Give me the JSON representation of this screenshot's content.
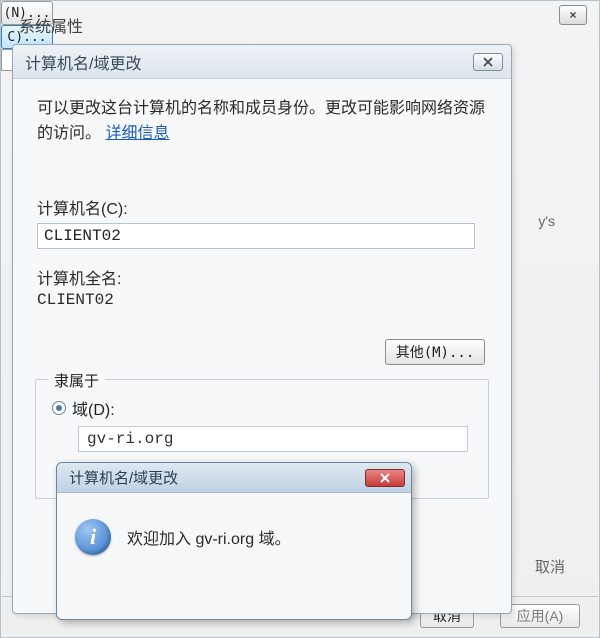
{
  "sys": {
    "title": "系统属性",
    "close_label": "×",
    "frag_ys": "y's",
    "frag_n": "(N)...",
    "frag_c": "C)...",
    "frag_cancel2": "取消",
    "frag_cancel3": "取消",
    "frag_apply": "应用(A)"
  },
  "dlg": {
    "title": "计算机名/域更改",
    "desc_prefix": "可以更改这台计算机的名称和成员身份。更改可能影响网络资源的访问。",
    "link_text": "详细信息",
    "name_label": "计算机名(C):",
    "name_value": "CLIENT02",
    "full_label": "计算机全名:",
    "full_value": "CLIENT02",
    "more_btn": "其他(M)...",
    "group_legend": "隶属于",
    "domain_radio_label": "域(D):",
    "domain_value": "gv-ri.org"
  },
  "msg": {
    "title": "计算机名/域更改",
    "text": "欢迎加入 gv-ri.org 域。",
    "icon_glyph": "i"
  }
}
